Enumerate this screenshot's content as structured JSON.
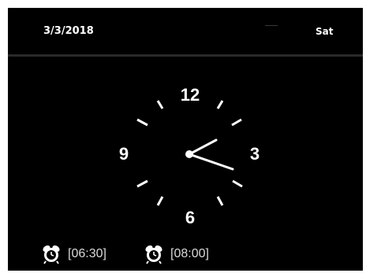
{
  "header": {
    "date": "3/3/2018",
    "day": "Sat"
  },
  "clock": {
    "numerals": {
      "twelve": "12",
      "three": "3",
      "six": "6",
      "nine": "9"
    },
    "hour_hand_icon": "clock-hour-hand",
    "minute_hand_icon": "clock-minute-hand"
  },
  "alarms": [
    {
      "icon": "alarm-clock-icon",
      "time": "[06:30]"
    },
    {
      "icon": "alarm-clock-icon",
      "time": "[08:00]"
    }
  ],
  "colors": {
    "background": "#000000",
    "foreground": "#ffffff",
    "divider": "#2a2a2a"
  }
}
